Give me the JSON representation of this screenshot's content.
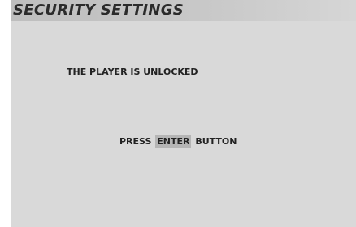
{
  "screen": {
    "title": "SECURITY SETTINGS",
    "message": "THE PLAYER IS UNLOCKED",
    "prompt_prefix": "PRESS",
    "prompt_key": "ENTER",
    "prompt_suffix": "BUTTON"
  },
  "colors": {
    "background": "#d9d9d9",
    "title_bar": "#c4c4c4",
    "key_highlight": "#b5b5b5",
    "text": "#222222"
  }
}
